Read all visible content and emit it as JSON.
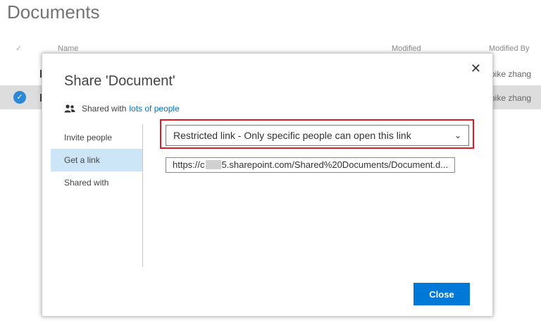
{
  "library": {
    "title": "Documents",
    "columns": {
      "check": "✓",
      "name": "Name",
      "modified": "Modified",
      "modified_by": "Modified By"
    },
    "rows": [
      {
        "modified_by": "pike zhang",
        "selected": false
      },
      {
        "modified_by": "pike zhang",
        "selected": true
      }
    ]
  },
  "dialog": {
    "title": "Share 'Document'",
    "close_glyph": "✕",
    "shared_prefix": "Shared with",
    "shared_link": "lots of people",
    "nav": [
      "Invite people",
      "Get a link",
      "Shared with"
    ],
    "active_nav": "Get a link",
    "link_type": "Restricted link - Only specific people can open this link",
    "url_prefix": "https://c",
    "url_suffix": "5.sharepoint.com/Shared%20Documents/Document.d...",
    "close_button": "Close"
  },
  "colors": {
    "accent": "#0078d7",
    "link": "#0072c6",
    "highlight_frame": "#e21b23",
    "active_nav_bg": "#cde6f7"
  },
  "icons": {
    "people": "people-icon",
    "close": "close-icon",
    "chevron": "chevron-down-icon",
    "select_check": "checkmark-icon"
  }
}
